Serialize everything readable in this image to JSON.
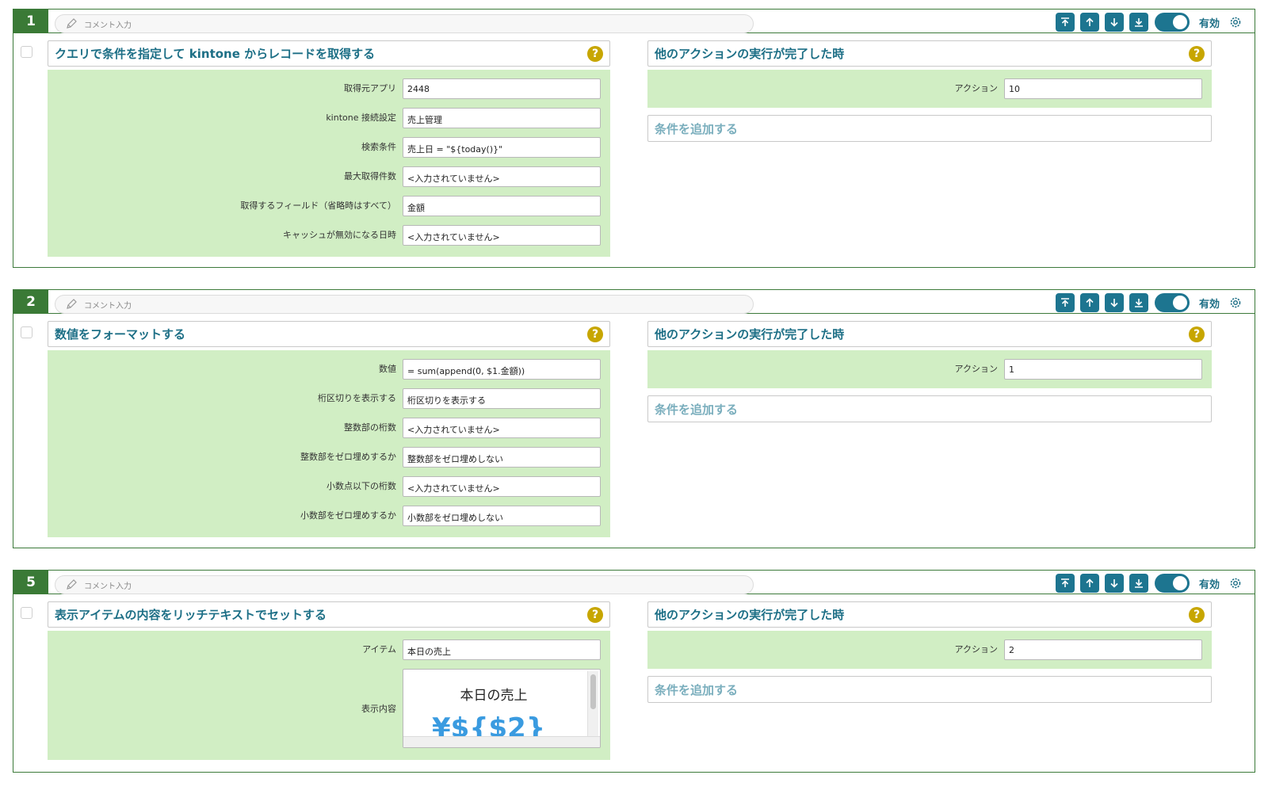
{
  "blocks": [
    {
      "number": "1",
      "comment_placeholder": "コメント入力",
      "enabled_label": "有効",
      "action": {
        "title": "クエリで条件を指定して kintone からレコードを取得する",
        "fields": [
          {
            "label": "取得元アプリ",
            "value": "2448"
          },
          {
            "label": "kintone 接続設定",
            "value": "売上管理"
          },
          {
            "label": "検索条件",
            "value": "売上日 = \"${today()}\""
          },
          {
            "label": "最大取得件数",
            "value": "<入力されていません>"
          },
          {
            "label": "取得するフィールド（省略時はすべて）",
            "value": "金額"
          },
          {
            "label": "キャッシュが無効になる日時",
            "value": "<入力されていません>"
          }
        ]
      },
      "trigger": {
        "title": "他のアクションの実行が完了した時",
        "action_label": "アクション",
        "action_value": "10",
        "add_condition": "条件を追加する"
      }
    },
    {
      "number": "2",
      "comment_placeholder": "コメント入力",
      "enabled_label": "有効",
      "action": {
        "title": "数値をフォーマットする",
        "fields": [
          {
            "label": "数値",
            "value": "= sum(append(0, $1.金額))"
          },
          {
            "label": "桁区切りを表示する",
            "value": "桁区切りを表示する"
          },
          {
            "label": "整数部の桁数",
            "value": "<入力されていません>"
          },
          {
            "label": "整数部をゼロ埋めするか",
            "value": "整数部をゼロ埋めしない"
          },
          {
            "label": "小数点以下の桁数",
            "value": "<入力されていません>"
          },
          {
            "label": "小数部をゼロ埋めするか",
            "value": "小数部をゼロ埋めしない"
          }
        ]
      },
      "trigger": {
        "title": "他のアクションの実行が完了した時",
        "action_label": "アクション",
        "action_value": "1",
        "add_condition": "条件を追加する"
      }
    },
    {
      "number": "5",
      "comment_placeholder": "コメント入力",
      "enabled_label": "有効",
      "action": {
        "title": "表示アイテムの内容をリッチテキストでセットする",
        "fields": [
          {
            "label": "アイテム",
            "value": "本日の売上"
          }
        ],
        "rich_label": "表示内容",
        "rich_title": "本日の売上",
        "rich_preview": "¥${$2}"
      },
      "trigger": {
        "title": "他のアクションの実行が完了した時",
        "action_label": "アクション",
        "action_value": "2",
        "add_condition": "条件を追加する"
      }
    }
  ],
  "help_symbol": "?",
  "colors": {
    "accent": "#1d7590",
    "block_border": "#3c7a3a",
    "number_bg": "#3a7a36",
    "field_area": "#d1eec4",
    "help": "#c7a600"
  }
}
